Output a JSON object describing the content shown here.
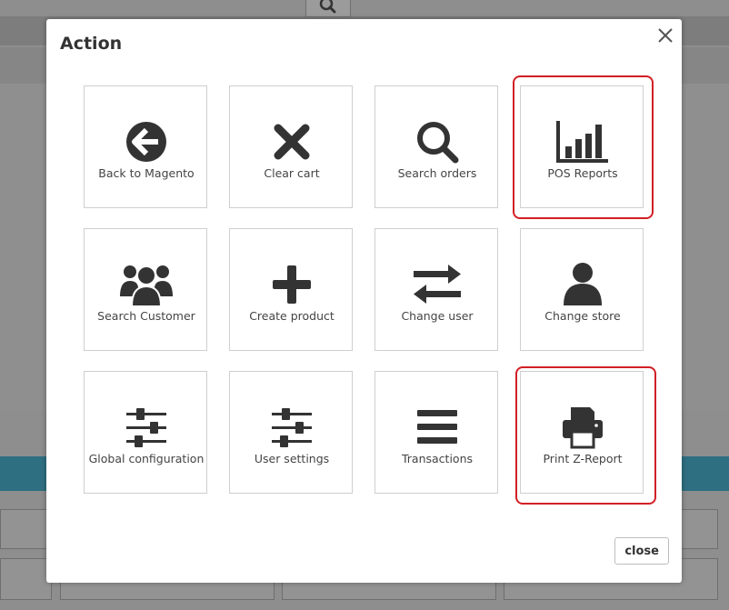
{
  "modal": {
    "title": "Action",
    "close_label": "close",
    "actions": [
      {
        "label": "Back to Magento",
        "icon": "arrow-circle-left-icon"
      },
      {
        "label": "Clear cart",
        "icon": "times-icon"
      },
      {
        "label": "Search orders",
        "icon": "search-icon"
      },
      {
        "label": "POS Reports",
        "icon": "bar-chart-icon"
      },
      {
        "label": "Search Customer",
        "icon": "users-icon"
      },
      {
        "label": "Create product",
        "icon": "plus-icon"
      },
      {
        "label": "Change user",
        "icon": "exchange-icon"
      },
      {
        "label": "Change store",
        "icon": "user-icon"
      },
      {
        "label": "Global configuration",
        "icon": "sliders-icon"
      },
      {
        "label": "User settings",
        "icon": "sliders-icon"
      },
      {
        "label": "Transactions",
        "icon": "bars-icon"
      },
      {
        "label": "Print Z-Report",
        "icon": "printer-icon"
      }
    ]
  },
  "colors": {
    "icon": "#333333",
    "highlight": "#d21f25",
    "tile_border": "#cfcfcf",
    "backdrop_accent": "#2e6f82"
  }
}
